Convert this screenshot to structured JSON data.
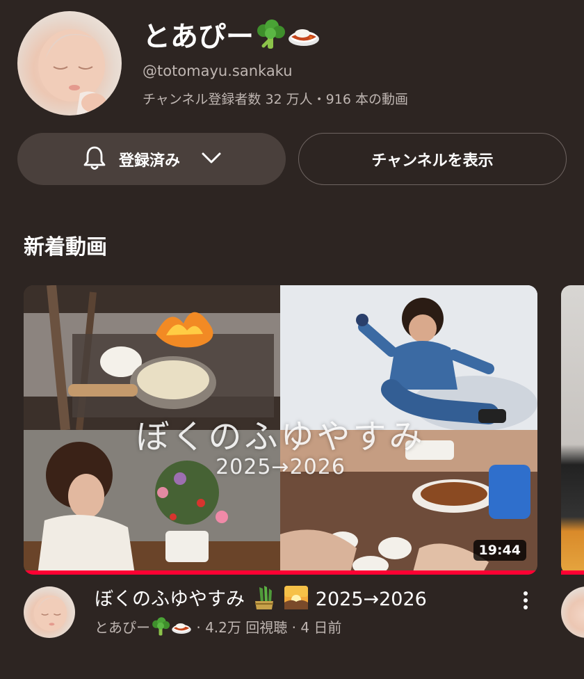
{
  "channel": {
    "name": "とあぴー",
    "handle": "@totomayu.sankaku",
    "meta": "チャンネル登録者数 32 万人・916 本の動画",
    "name_emoji_icons": [
      "broccoli-icon",
      "curry-rice-icon"
    ]
  },
  "buttons": {
    "subscribed_label": "登録済み",
    "view_channel_label": "チャンネルを表示"
  },
  "section": {
    "title": "新着動画"
  },
  "video": {
    "thumbnail_title": "ぼくのふゆやすみ",
    "thumbnail_subtitle": "2025→2026",
    "duration": "19:44",
    "title_text": "ぼくのふゆやすみ",
    "title_year": "2025→2026",
    "title_emoji_icons": [
      "kadomatsu-icon",
      "sunrise-icon"
    ],
    "channel_name": "とあぴー",
    "views": "· 4.2万 回視聴",
    "age": "· 4 日前",
    "watched_fraction": 1.0
  },
  "colors": {
    "background": "#2d2522",
    "button_bg": "#4a403c",
    "progress": "#ff0033",
    "secondary_text": "#bfb6b2"
  }
}
